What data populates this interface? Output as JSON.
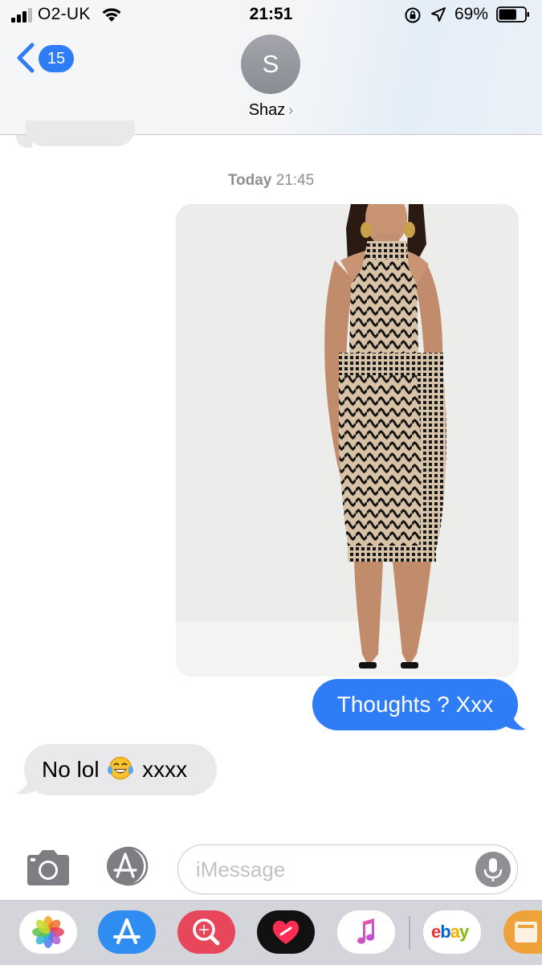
{
  "status_bar": {
    "carrier": "O2-UK",
    "time": "21:51",
    "battery_percent": "69%",
    "battery_level": 0.69,
    "signal_bars_filled": 3,
    "signal_bars_total": 4
  },
  "header": {
    "back_badge_count": "15",
    "contact_initial": "S",
    "contact_name": "Shaz",
    "chevron": "›"
  },
  "conversation": {
    "timestamp_day": "Today",
    "timestamp_time": "21:45",
    "photo_icon": "dress-photo",
    "outgoing_message": "Thoughts ? Xxx",
    "incoming_text_before_emoji": "No lol",
    "incoming_emoji": "face-with-tears-of-joy",
    "incoming_text_after_emoji": "xxxx"
  },
  "input_bar": {
    "placeholder": "iMessage"
  },
  "app_drawer": {
    "apps": [
      "photos-icon",
      "app-store-icon",
      "search-web-icon",
      "digital-touch-icon",
      "music-icon",
      "ebay-icon",
      "partial-app-icon"
    ],
    "ebay_label": "ebay"
  },
  "colors": {
    "imessage_blue": "#2f7df6",
    "incoming_gray": "#e9e9eb",
    "badge_blue": "#2e7cf6"
  }
}
